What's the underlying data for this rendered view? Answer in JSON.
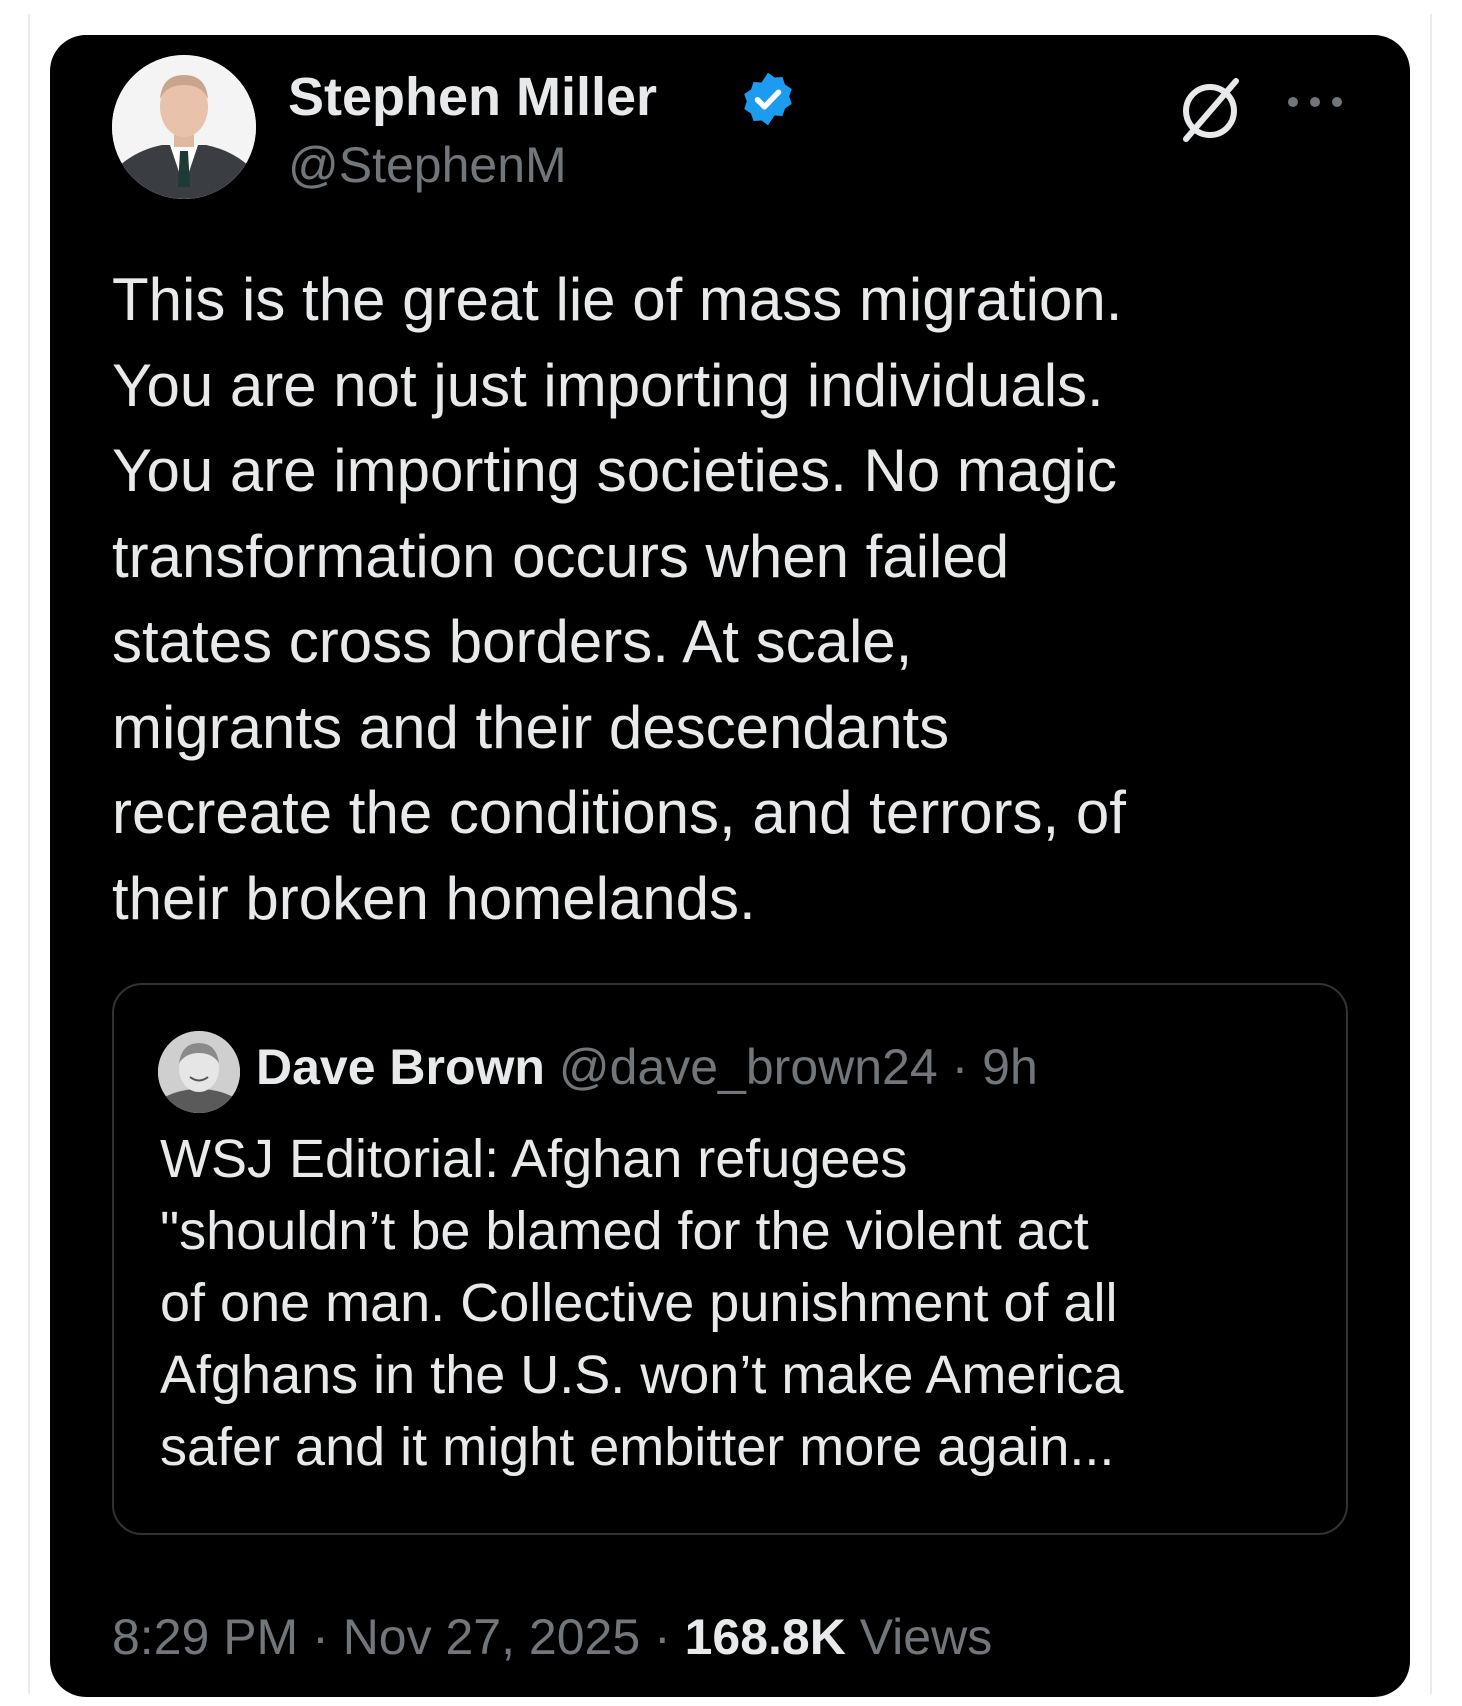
{
  "tweet": {
    "author_name": "Stephen Miller",
    "author_handle": "@StephenM",
    "verified_badge": "verified-badge-icon",
    "text": "This is the great lie of mass migration.\nYou are not just importing individuals.\nYou are importing societies. No magic\ntransformation occurs when failed\nstates cross borders. At scale,\nmigrants and their descendants\nrecreate the conditions, and terrors, of\ntheir broken homelands.",
    "time": "8:29 PM",
    "date": "Nov 27, 2025",
    "separator": "·",
    "views_count": "168.8K",
    "views_label": "Views"
  },
  "quote": {
    "author_name": "Dave Brown",
    "author_handle": "@dave_brown24",
    "separator": "·",
    "age": "9h",
    "text": "WSJ Editorial: Afghan refugees\n\"shouldn’t be blamed for the violent act\nof one man. Collective punishment of all\nAfghans in the U.S. won’t make America\nsafer and it might embitter more again..."
  },
  "icons": {
    "grok": "grok-icon",
    "more": "more-options-icon"
  },
  "colors": {
    "background": "#000000",
    "text": "#e7e9ea",
    "secondary_text": "#71767b",
    "verified": "#1d9bf0",
    "border": "#2f3336"
  }
}
